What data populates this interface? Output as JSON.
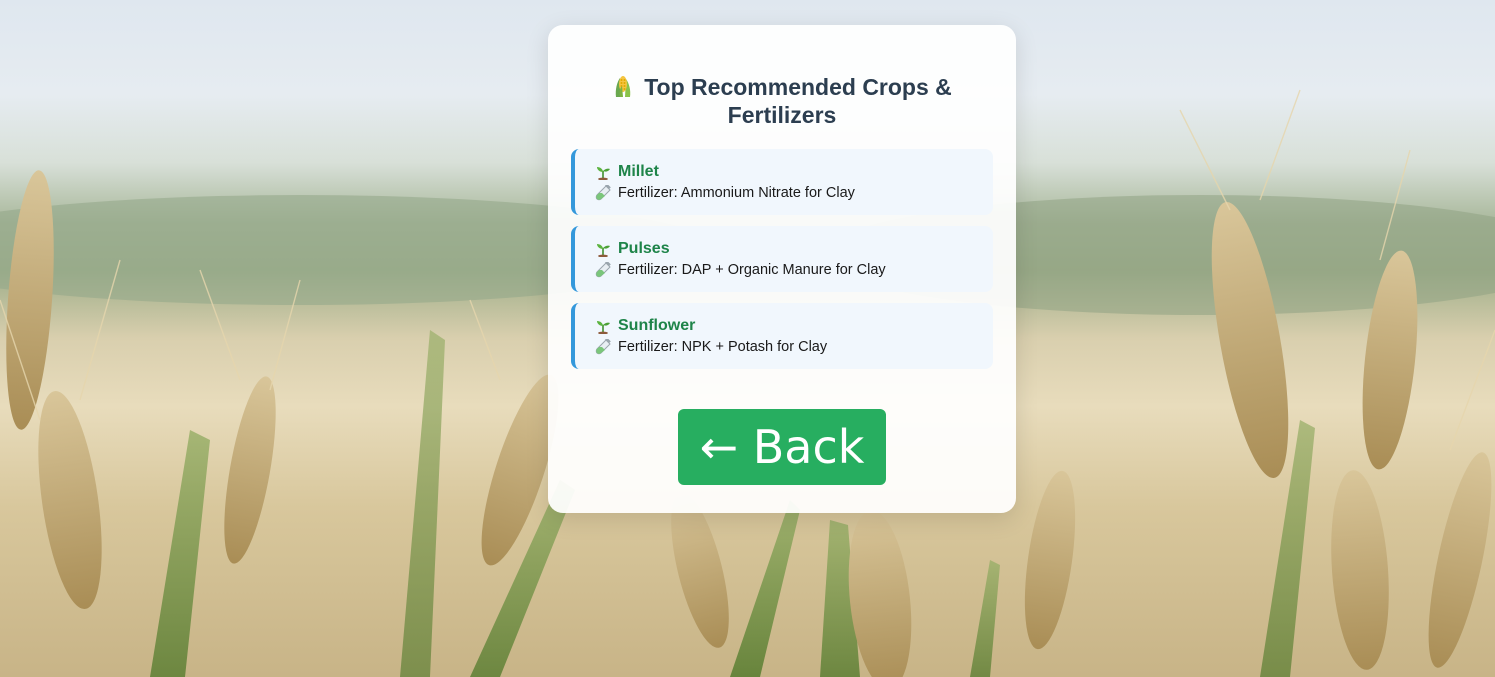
{
  "page": {
    "title": "Top Recommended Crops & Fertilizers",
    "title_icon": "ear-of-corn-icon"
  },
  "recommendations": [
    {
      "crop": "Millet",
      "fertilizer": "Fertilizer: Ammonium Nitrate for Clay"
    },
    {
      "crop": "Pulses",
      "fertilizer": "Fertilizer: DAP + Organic Manure for Clay"
    },
    {
      "crop": "Sunflower",
      "fertilizer": "Fertilizer: NPK + Potash for Clay"
    }
  ],
  "back_button": {
    "label": "← Back"
  },
  "colors": {
    "title": "#2c3e50",
    "crop_name": "#1e8449",
    "item_border": "#3498db",
    "item_background": "#f1f7fd",
    "button": "#27ae60"
  },
  "icons": {
    "crop": "seedling-icon",
    "fertilizer": "test-tube-icon",
    "background": "wheat-field-photo"
  }
}
